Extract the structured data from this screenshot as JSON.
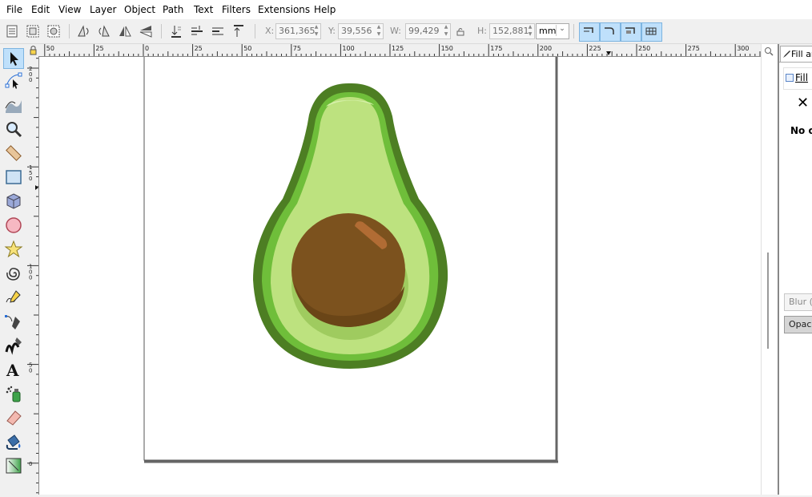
{
  "menu": [
    "File",
    "Edit",
    "View",
    "Layer",
    "Object",
    "Path",
    "Text",
    "Filters",
    "Extensions",
    "Help"
  ],
  "toolbar": {
    "x_label": "X:",
    "x_value": "361,365",
    "y_label": "Y:",
    "y_value": "39,556",
    "w_label": "W:",
    "w_value": "99,429",
    "h_label": "H:",
    "h_value": "152,881",
    "unit": "mm"
  },
  "ruler_top_labels": [
    "50",
    "25",
    "0",
    "25",
    "50",
    "75",
    "100",
    "125",
    "150",
    "175",
    "200",
    "225",
    "250",
    "275",
    "300"
  ],
  "ruler_left_labels": [
    "200",
    "150",
    "100",
    "50",
    "0"
  ],
  "dock": {
    "tab_label": "Fill and Stroke",
    "fill_tab": "Fill",
    "no_object_text": "No objects",
    "blur_label": "Blur (%)",
    "opacity_label": "Opacity (%)"
  },
  "colors": {
    "avocado_dark": "#4d7e23",
    "avocado_mid": "#6fbe3a",
    "avocado_light": "#bde27f",
    "pit": "#7c521e",
    "accent": "#bfe0fb"
  }
}
